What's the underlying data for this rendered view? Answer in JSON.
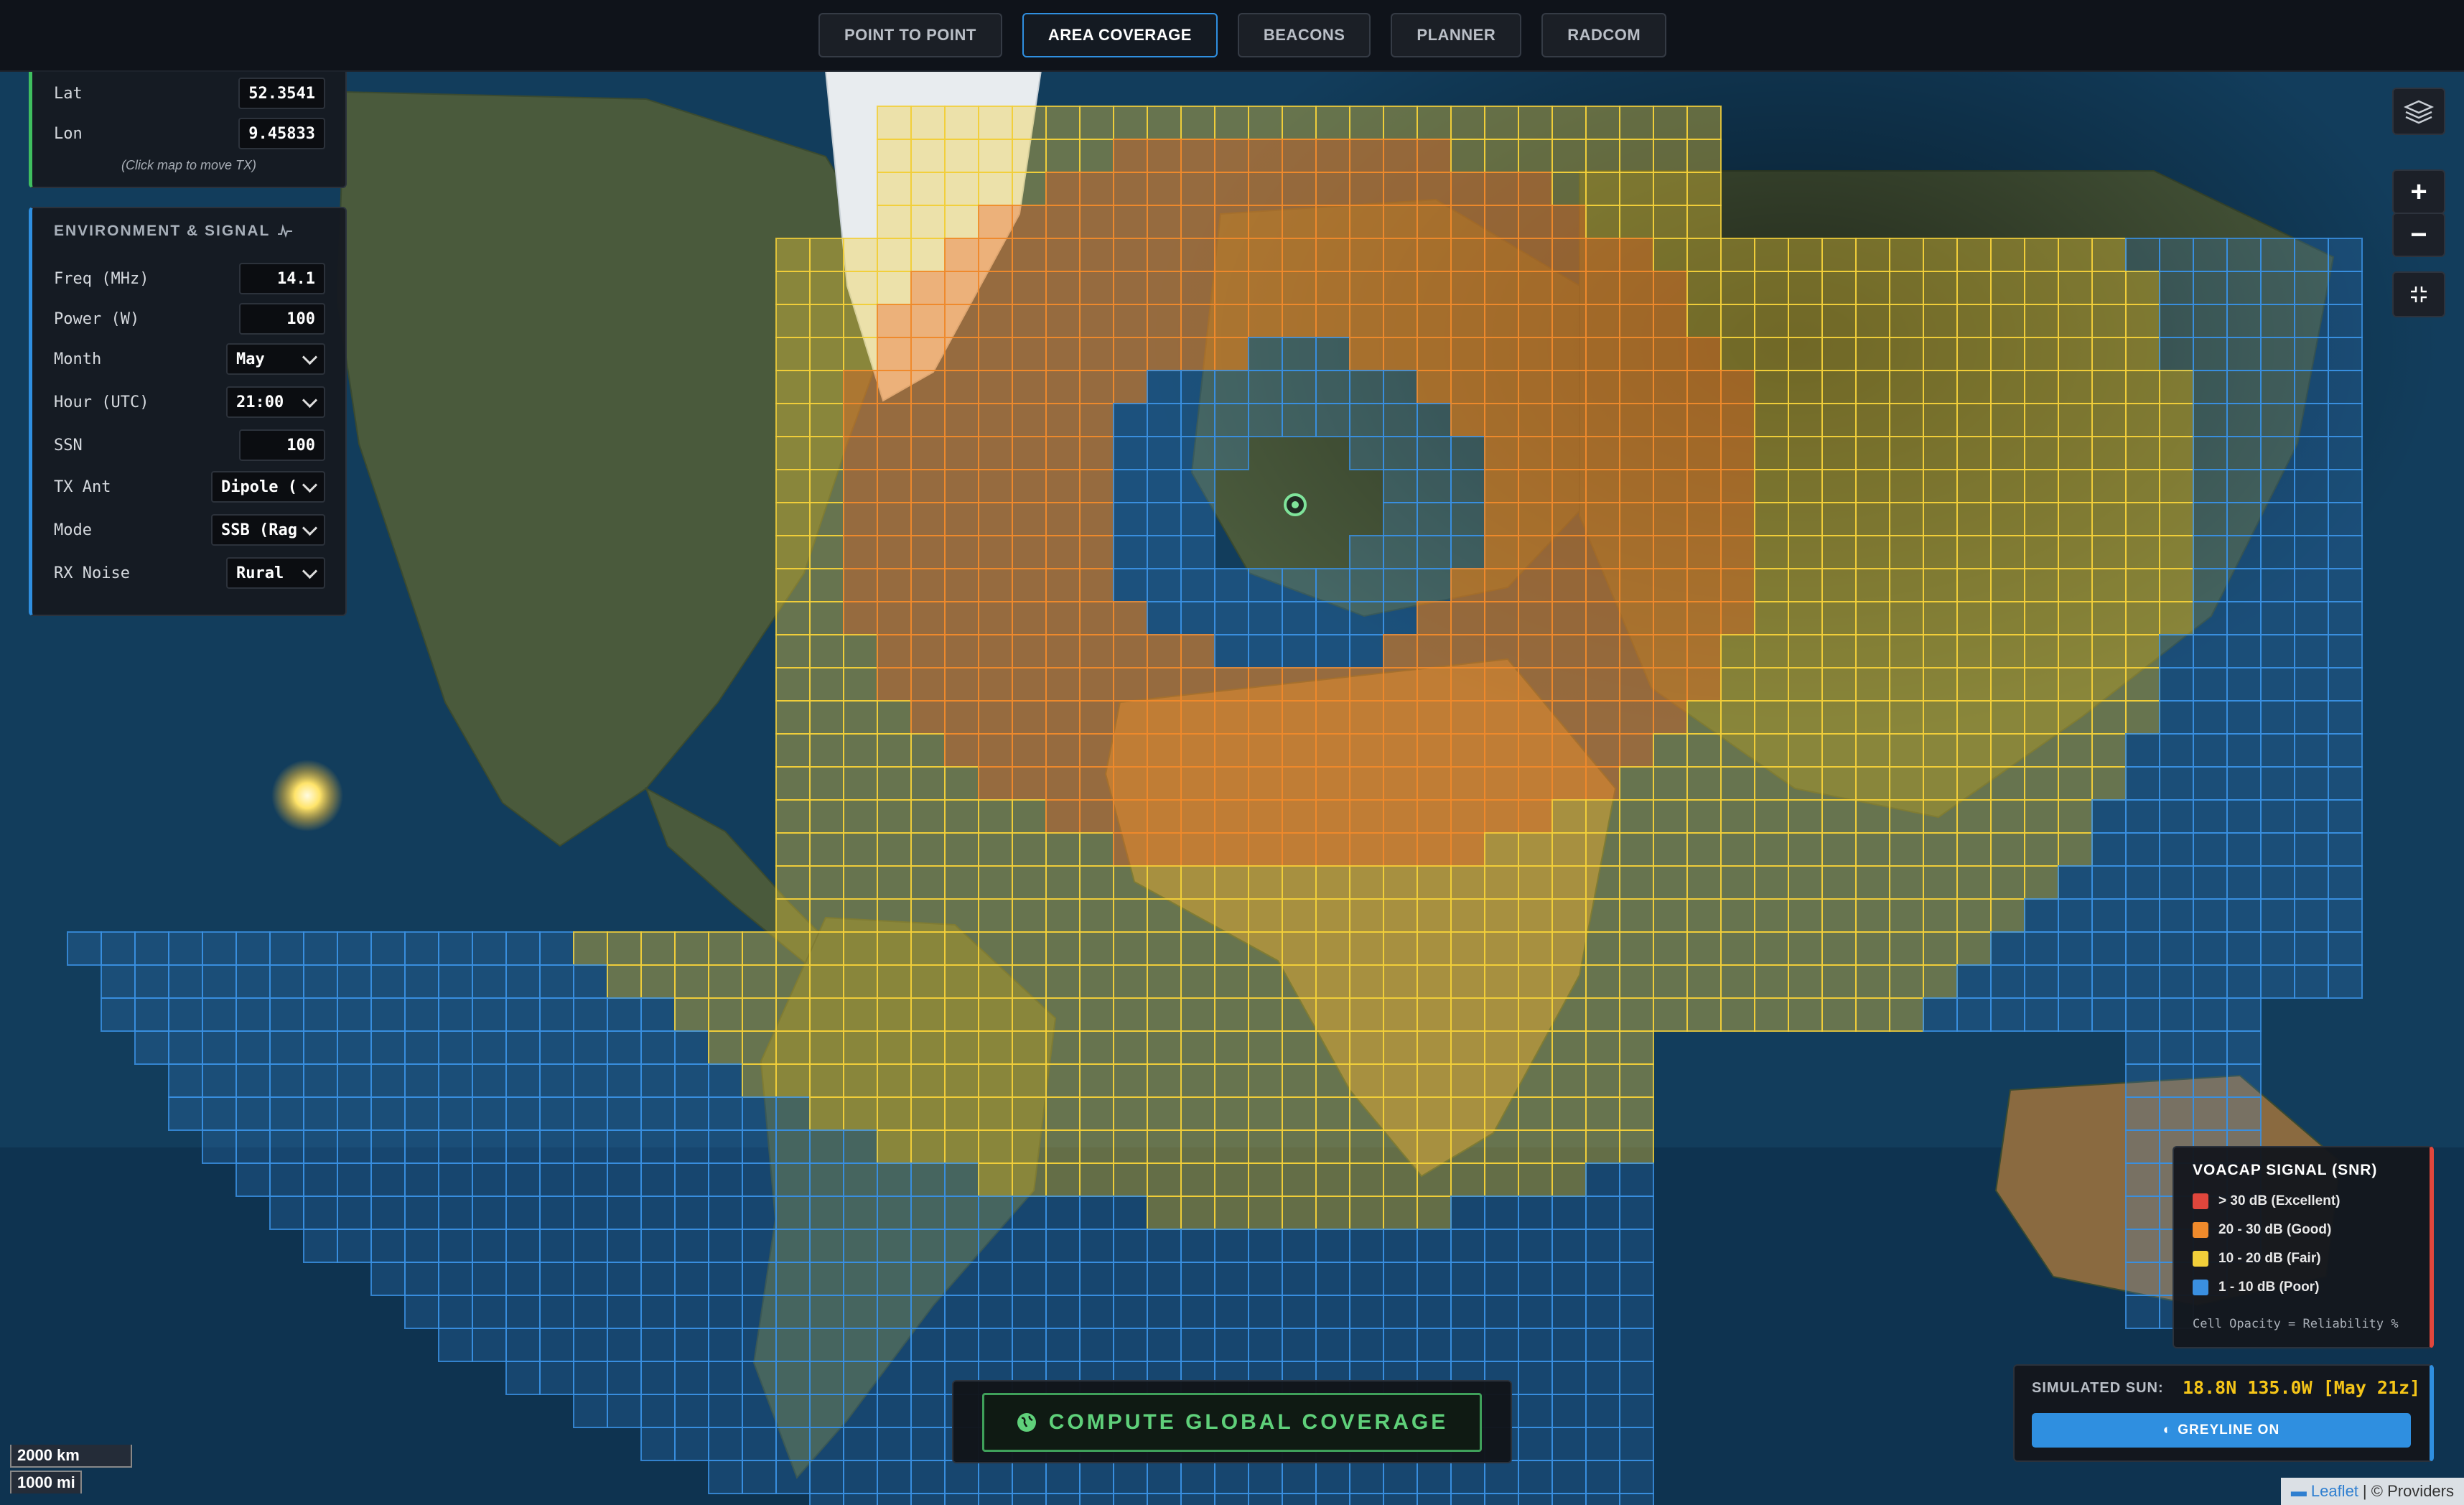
{
  "tabs": [
    {
      "label": "POINT TO POINT",
      "active": false
    },
    {
      "label": "AREA COVERAGE",
      "active": true
    },
    {
      "label": "BEACONS",
      "active": false
    },
    {
      "label": "PLANNER",
      "active": false
    },
    {
      "label": "RADCOM",
      "active": false
    }
  ],
  "tx_panel": {
    "lat_label": "Lat",
    "lat_value": "52.3541",
    "lon_label": "Lon",
    "lon_value": "9.45833",
    "hint": "(Click map to move TX)"
  },
  "env_panel": {
    "title": "ENVIRONMENT & SIGNAL",
    "fields": [
      {
        "label": "Freq (MHz)",
        "value": "14.1",
        "type": "input"
      },
      {
        "label": "Power (W)",
        "value": "100",
        "type": "input"
      },
      {
        "label": "Month",
        "value": "May",
        "type": "select"
      },
      {
        "label": "Hour (UTC)",
        "value": "21:00",
        "type": "select"
      },
      {
        "label": "SSN",
        "value": "100",
        "type": "input"
      },
      {
        "label": "TX Ant",
        "value": "Dipole (",
        "type": "select"
      },
      {
        "label": "Mode",
        "value": "SSB (Rag",
        "type": "select"
      },
      {
        "label": "RX Noise",
        "value": "Rural",
        "type": "select"
      }
    ]
  },
  "map_controls": {
    "zoom_in": "+",
    "zoom_out": "−"
  },
  "legend": {
    "title": "VOACAP SIGNAL (SNR)",
    "items": [
      {
        "label": "> 30 dB (Excellent)",
        "color": "#e0463c"
      },
      {
        "label": "20 - 30 dB (Good)",
        "color": "#ef8a2c"
      },
      {
        "label": "10 - 20 dB (Fair)",
        "color": "#f2cf3a"
      },
      {
        "label": "1 - 10 dB (Poor)",
        "color": "#3a8fe0"
      }
    ],
    "note": "Cell Opacity = Reliability %"
  },
  "sun_box": {
    "label": "SIMULATED SUN:",
    "value": "18.8N 135.0W [May 21z]",
    "greyline_label": "GREYLINE ON"
  },
  "compute_button": "COMPUTE GLOBAL COVERAGE",
  "scale": {
    "km": "2000 km",
    "mi": "1000 mi"
  },
  "attribution": {
    "leaflet": "Leaflet",
    "providers": "| © Providers"
  },
  "colors": {
    "accent": "#2f8fe0",
    "success": "#3fbf5f",
    "sun": "#f5c518"
  }
}
